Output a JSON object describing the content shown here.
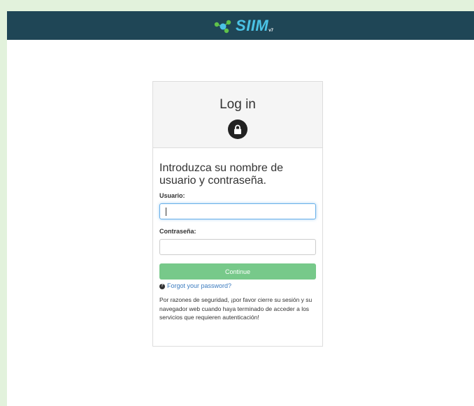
{
  "header": {
    "logo_text": "SIIM",
    "logo_sub": "v7",
    "colors": {
      "bar": "#1f4656",
      "logo": "#4bc3e6",
      "logo_nodes": "#5fc24a"
    }
  },
  "login": {
    "title": "Log in",
    "lock_icon": "lock-icon",
    "intro": "Introduzca su nombre de usuario y contraseña.",
    "username_label": "Usuario:",
    "username_value": "",
    "password_label": "Contraseña:",
    "password_value": "",
    "continue_label": "Continue",
    "forgot_label": "Forgot your password?",
    "forgot_icon": "question-circle-icon",
    "notice": "Por razones de seguridad, ¡por favor cierre su sesión y su navegador web cuando haya terminado de acceder a los servicios que requieren autenticación!",
    "colors": {
      "continue": "#77c98a",
      "link": "#3b7bbf"
    }
  }
}
